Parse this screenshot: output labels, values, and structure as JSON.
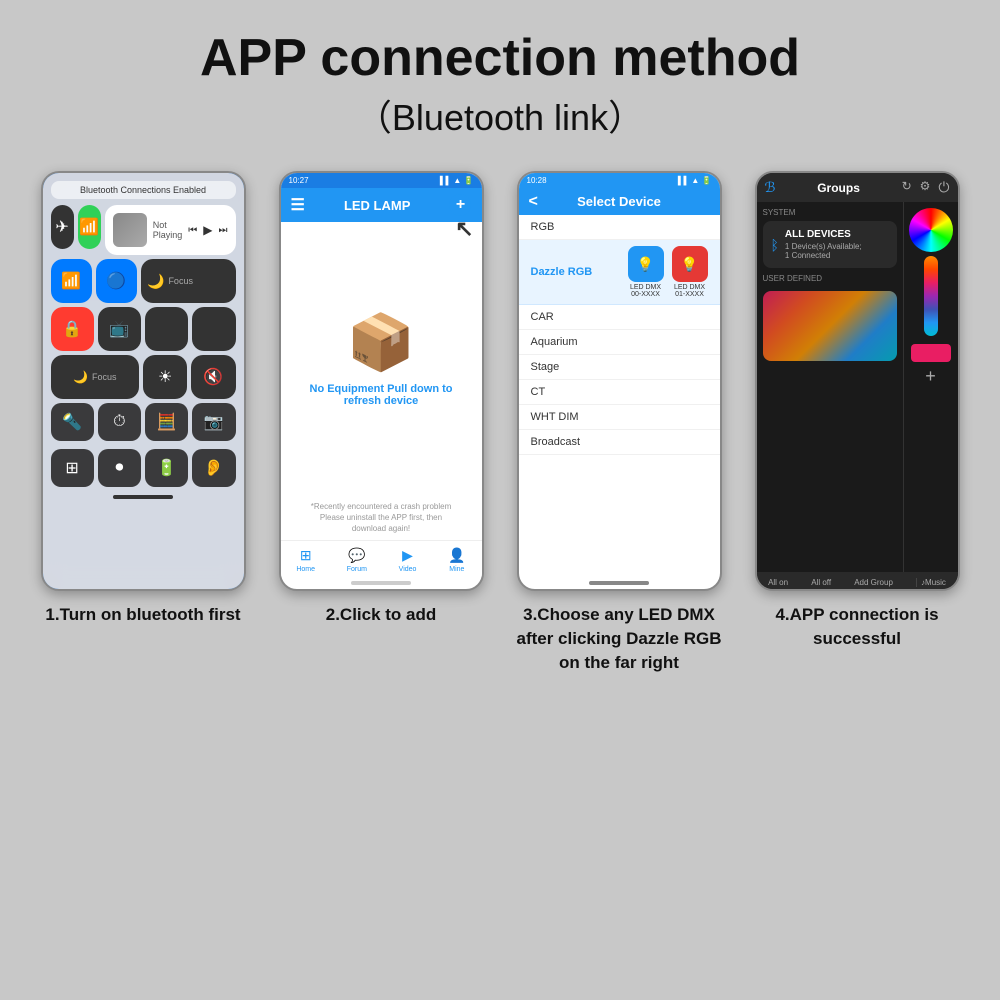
{
  "header": {
    "title": "APP connection method",
    "subtitle": "（Bluetooth link）"
  },
  "steps": [
    {
      "id": 1,
      "label": "1.Turn on bluetooth first",
      "phone": {
        "bt_banner": "Bluetooth Connections Enabled",
        "not_playing": "Not Playing"
      }
    },
    {
      "id": 2,
      "label": "2.Click to add",
      "phone": {
        "time": "10:27",
        "app_title": "LED LAMP",
        "empty_text": "No Equipment  Pull down to\nrefresh device",
        "note": "*Recently encountered a crash problem\nPlease uninstall the APP first, then\ndownload again!",
        "nav": [
          "Home",
          "Forum",
          "Video",
          "Mine"
        ]
      }
    },
    {
      "id": 3,
      "label": "3.Choose any LED DMX after clicking Dazzle RGB on the far right",
      "phone": {
        "time": "10:28",
        "screen_title": "Select Device",
        "back": "<",
        "list_items": [
          "RGB",
          "Dazzle RGB",
          "CAR",
          "Aquarium",
          "Stage",
          "CT",
          "WHT DIM",
          "Broadcast"
        ],
        "device1_name": "LED DMX\n00-XXXX",
        "device2_name": "LED DMX\n01-XXXX"
      }
    },
    {
      "id": 4,
      "label": "4.APP connection is successful",
      "phone": {
        "section": "SYSTEM",
        "groups": "Groups",
        "all_devices": "ALL DEVICES",
        "device_count": "1 Device(s) Available;\n1 Connected",
        "user_defined": "USER DEFINED",
        "bottom_btns": [
          "All on",
          "All off",
          "Add Group",
          "Music"
        ]
      }
    }
  ]
}
